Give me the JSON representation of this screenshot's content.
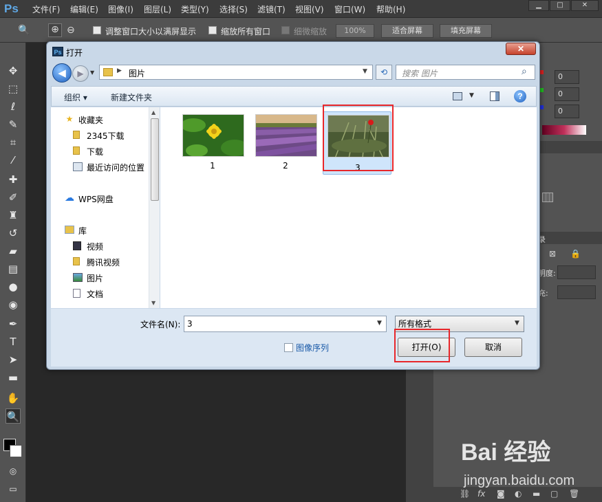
{
  "app": {
    "logo": "Ps",
    "menu": [
      "文件(F)",
      "编辑(E)",
      "图像(I)",
      "图层(L)",
      "类型(Y)",
      "选择(S)",
      "滤镜(T)",
      "视图(V)",
      "窗口(W)",
      "帮助(H)"
    ],
    "window_buttons": [
      "▁",
      "□",
      "✕"
    ]
  },
  "options_bar": {
    "resize_windows_label": "调整窗口大小以满屏显示",
    "zoom_all_label": "缩放所有窗口",
    "scrubby_zoom_label": "细微缩放",
    "zoom_100": "100%",
    "fit_screen": "适合屏幕",
    "fill_screen": "填充屏幕"
  },
  "right_panel": {
    "color_values": [
      "0",
      "0",
      "0"
    ],
    "layers_tab_partial": "录",
    "opacity_partial": "明度:",
    "fill_partial": "充:"
  },
  "dialog": {
    "title": "打开",
    "close_label": "✕",
    "address": {
      "path": "图片",
      "search_placeholder": "搜索 图片"
    },
    "toolbar": {
      "organize": "组织 ▾",
      "new_folder": "新建文件夹"
    },
    "nav_items": [
      {
        "label": "收藏夹",
        "icon": "star-icon"
      },
      {
        "label": "2345下载",
        "icon": "folder-icon"
      },
      {
        "label": "下载",
        "icon": "folder-icon"
      },
      {
        "label": "最近访问的位置",
        "icon": "recent-icon"
      },
      {
        "label": "WPS网盘",
        "icon": "cloud-icon"
      },
      {
        "label": "库",
        "icon": "library-icon"
      },
      {
        "label": "视频",
        "icon": "video-icon"
      },
      {
        "label": "腾讯视频",
        "icon": "folder-icon"
      },
      {
        "label": "图片",
        "icon": "picture-icon"
      },
      {
        "label": "文档",
        "icon": "document-icon"
      }
    ],
    "files": [
      {
        "name": "1",
        "thumb": "yellow-flower"
      },
      {
        "name": "2",
        "thumb": "lavender-field"
      },
      {
        "name": "3",
        "thumb": "poppy-grass",
        "selected": true
      }
    ],
    "filename_label": "文件名(N):",
    "filename_value": "3",
    "filetype_value": "所有格式",
    "image_sequence_label": "图像序列",
    "open_button": "打开(O)",
    "cancel_button": "取消"
  },
  "watermark": {
    "brand": "Bai 经验",
    "url": "jingyan.baidu.com"
  }
}
